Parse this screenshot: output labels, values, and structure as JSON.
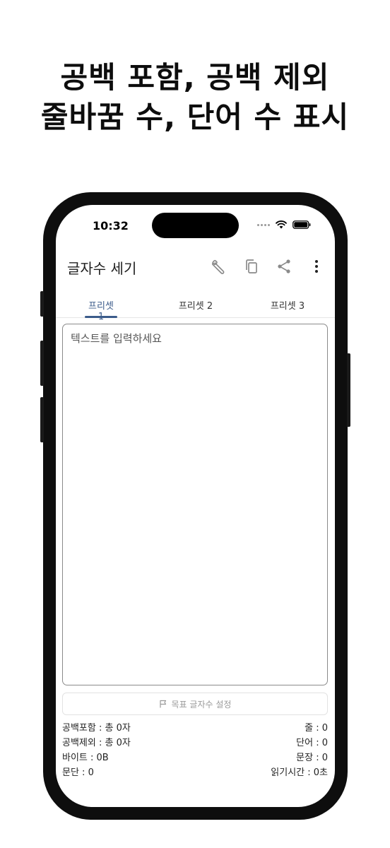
{
  "headline": {
    "line1": "공백 포함, 공백 제외",
    "line2": "줄바꿈 수, 단어 수 표시"
  },
  "status_bar": {
    "time": "10:32"
  },
  "app_bar": {
    "title": "글자수 세기",
    "icons": [
      "wrench-icon",
      "copy-icon",
      "share-icon",
      "more-vert-icon"
    ]
  },
  "tabs": [
    {
      "label": "프리셋 1",
      "active": true
    },
    {
      "label": "프리셋 2",
      "active": false
    },
    {
      "label": "프리셋 3",
      "active": false
    }
  ],
  "editor": {
    "placeholder": "텍스트를 입력하세요"
  },
  "target_button": {
    "label": "목표 글자수 설정",
    "icon": "flag-icon"
  },
  "stats": {
    "with_spaces": "공백포함 : 총 0자",
    "without_spaces": "공백제외 : 총 0자",
    "bytes": "바이트 : 0B",
    "paragraphs": "문단 : 0",
    "lines": "줄 : 0",
    "words": "단어 : 0",
    "sentences": "문장 : 0",
    "reading_time": "읽기시간 : 0초"
  },
  "colors": {
    "accent": "#3b5b8a",
    "phone_frame": "#0e0e0e",
    "background": "#ffffff"
  }
}
